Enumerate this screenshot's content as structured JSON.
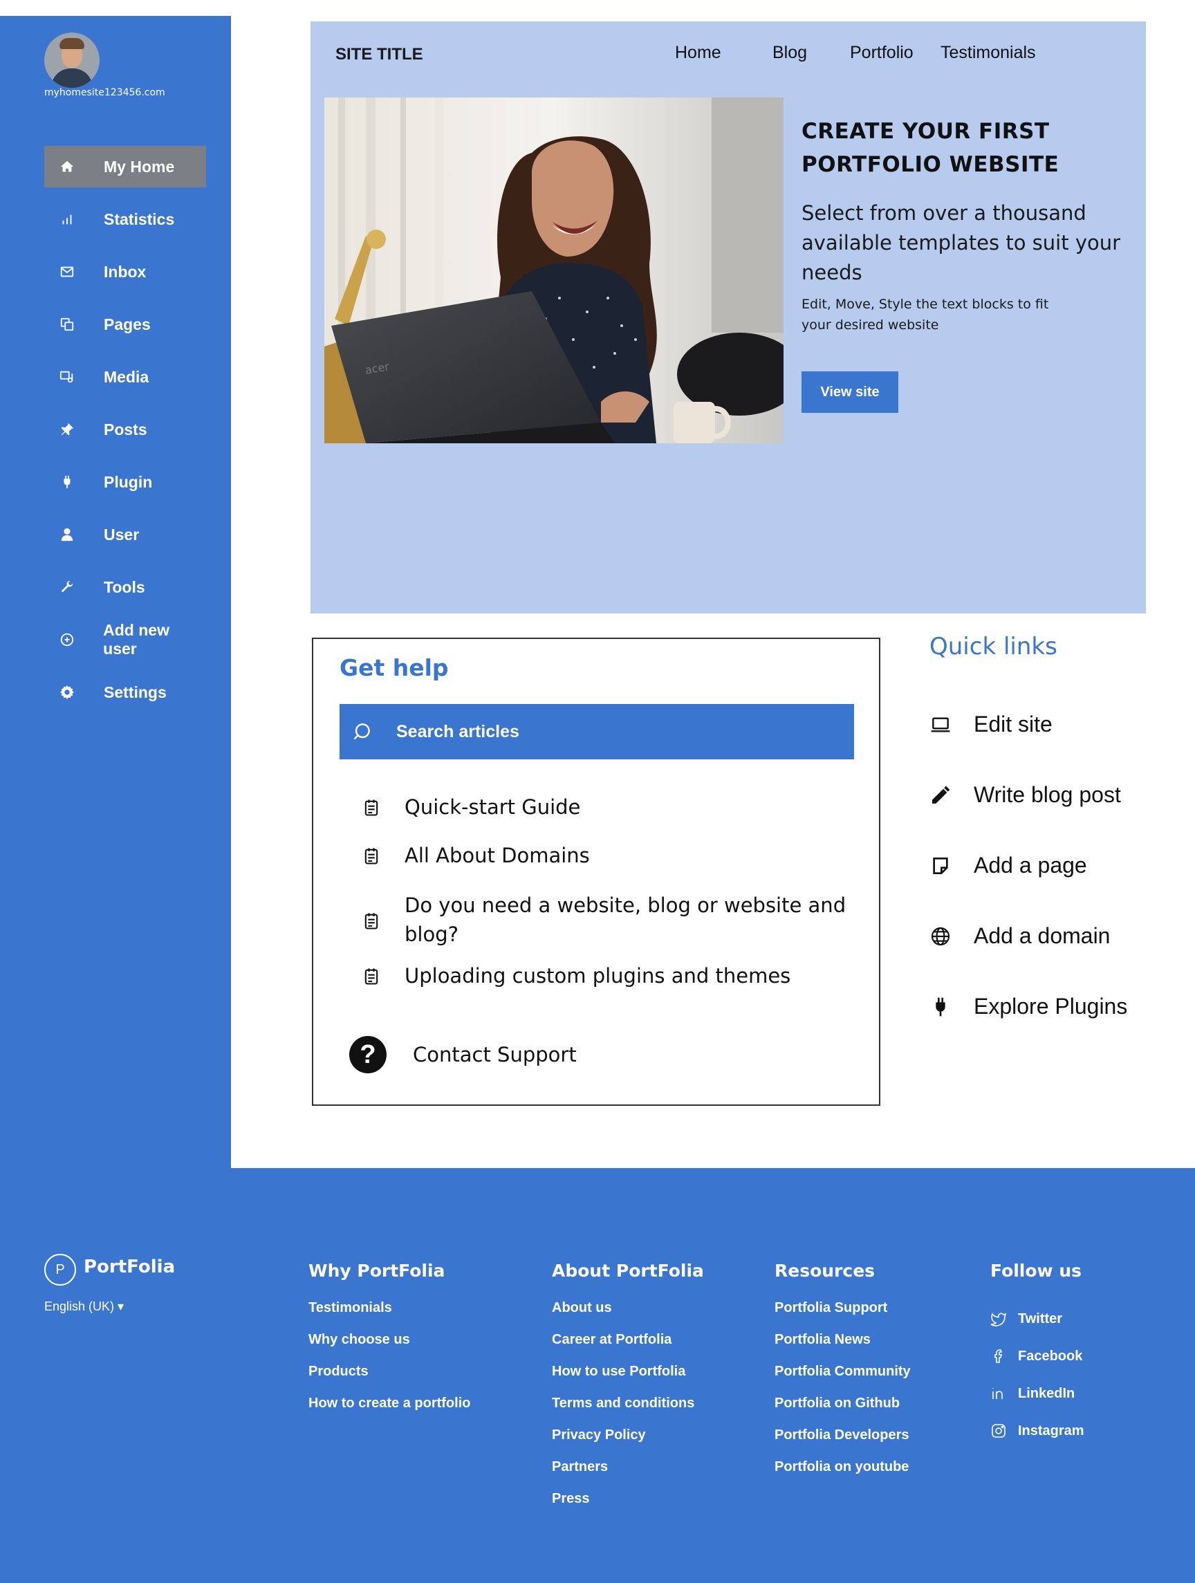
{
  "sidebar": {
    "site_url": "myhomesite123456.com",
    "items": [
      {
        "label": "My Home",
        "icon": "home-icon"
      },
      {
        "label": "Statistics",
        "icon": "bar-chart-icon"
      },
      {
        "label": "Inbox",
        "icon": "mail-icon"
      },
      {
        "label": "Pages",
        "icon": "pages-icon"
      },
      {
        "label": "Media",
        "icon": "media-icon"
      },
      {
        "label": "Posts",
        "icon": "pin-icon"
      },
      {
        "label": "Plugin",
        "icon": "plug-icon"
      },
      {
        "label": "User",
        "icon": "user-icon"
      },
      {
        "label": "Tools",
        "icon": "wrench-icon"
      },
      {
        "label": "Add new user",
        "icon": "plus-circle-icon"
      },
      {
        "label": "Settings",
        "icon": "gear-icon"
      }
    ],
    "active": "My Home"
  },
  "hero": {
    "site_title": "SITE TITLE",
    "nav": [
      "Home",
      "Blog",
      "Portfolio",
      "Testimonials"
    ],
    "heading": "CREATE YOUR FIRST PORTFOLIO WEBSITE",
    "subheading": "Select from over a thousand available templates to suit your needs",
    "small_text": "Edit, Move, Style the text blocks to fit your desired website",
    "button": "View site",
    "laptop_brand": "acer"
  },
  "help": {
    "title": "Get help",
    "search_placeholder": "Search articles",
    "articles": [
      "Quick-start Guide",
      "All About Domains",
      "Do you need a website, blog or website and blog?",
      "Uploading custom plugins and themes"
    ],
    "contact": "Contact Support"
  },
  "quick_links": {
    "title": "Quick links",
    "items": [
      {
        "label": "Edit site",
        "icon": "laptop-icon"
      },
      {
        "label": "Write blog post",
        "icon": "pencil-icon"
      },
      {
        "label": "Add a page",
        "icon": "page-icon"
      },
      {
        "label": "Add a domain",
        "icon": "globe-icon"
      },
      {
        "label": "Explore Plugins",
        "icon": "plug-icon"
      }
    ]
  },
  "footer": {
    "logo_letter": "P",
    "brand": "PortFolia",
    "language": "English (UK)",
    "columns": [
      {
        "title": "Why PortFolia",
        "links": [
          "Testimonials",
          "Why choose us",
          "Products",
          "How to create a portfolio"
        ]
      },
      {
        "title": "About PortFolia",
        "links": [
          "About us",
          "Career at Portfolia",
          "How to use Portfolia",
          "Terms and conditions",
          "Privacy Policy",
          "Partners",
          "Press"
        ]
      },
      {
        "title": "Resources",
        "links": [
          "Portfolia Support",
          "Portfolia News",
          "Portfolia Community",
          "Portfolia on Github",
          "Portfolia Developers",
          "Portfolia on youtube"
        ]
      },
      {
        "title": "Follow us",
        "links": [
          "Twitter",
          "Facebook",
          "LinkedIn",
          "Instagram"
        ]
      }
    ]
  },
  "colors": {
    "primary": "#3a75d0",
    "hero_bg": "#b6cbee",
    "active_item": "#7c7f85"
  }
}
